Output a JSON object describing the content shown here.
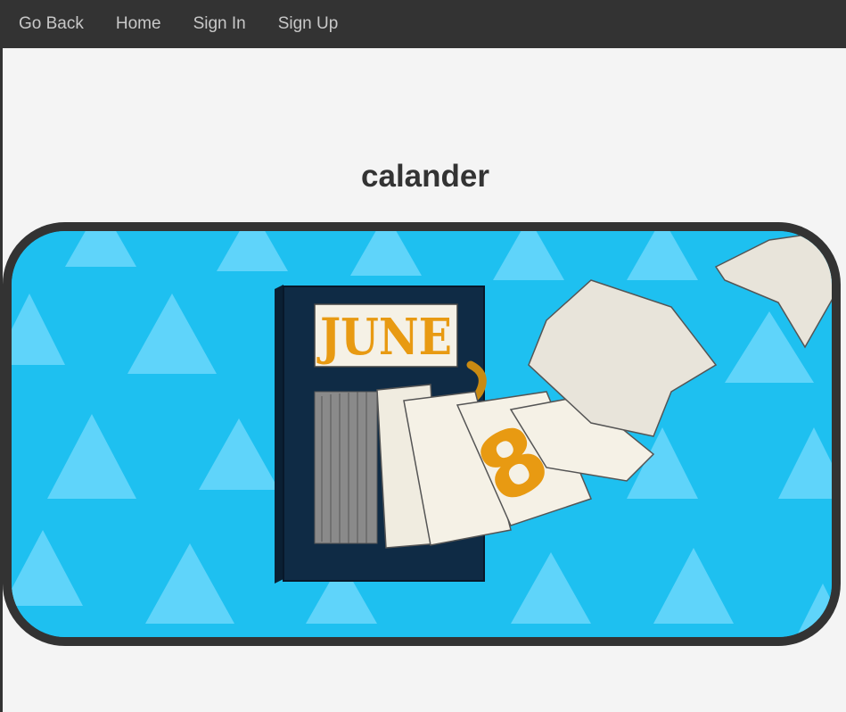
{
  "nav": {
    "items": [
      {
        "label": "Go Back",
        "name": "nav-go-back"
      },
      {
        "label": "Home",
        "name": "nav-home"
      },
      {
        "label": "Sign In",
        "name": "nav-sign-in"
      },
      {
        "label": "Sign Up",
        "name": "nav-sign-up"
      }
    ]
  },
  "page": {
    "title": "calander"
  },
  "image": {
    "month_text": "JUNE",
    "day_text": "8",
    "colors": {
      "background": "#1ec0f0",
      "triangles": "#5fd4fa",
      "calendar_body": "#0f2b45",
      "month_text": "#e89a12",
      "page": "#f5f1e6"
    }
  },
  "colors": {
    "navbar": "#333333",
    "nav_text": "#c8c8c8",
    "page_background": "#f4f4f4",
    "frame_border": "#333333"
  }
}
